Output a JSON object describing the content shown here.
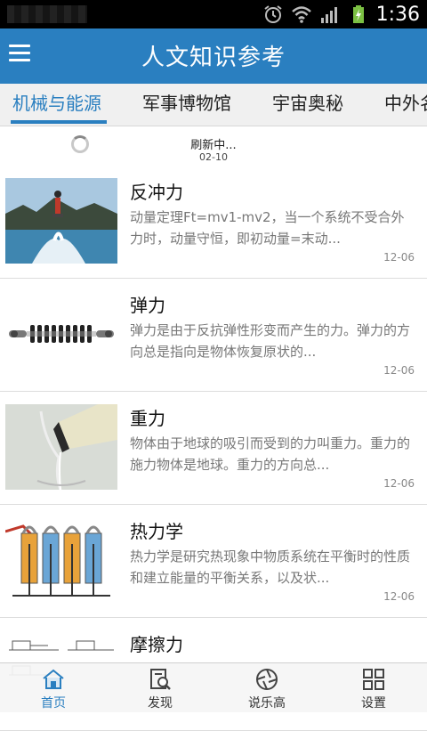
{
  "status_bar": {
    "time": "1:36"
  },
  "app_bar": {
    "title": "人文知识参考"
  },
  "tabs": [
    {
      "label": "机械与能源",
      "active": true
    },
    {
      "label": "军事博物馆",
      "active": false
    },
    {
      "label": "宇宙奥秘",
      "active": false
    },
    {
      "label": "中外名",
      "active": false
    }
  ],
  "refresh": {
    "label": "刷新中...",
    "date": "02-10"
  },
  "articles": [
    {
      "title": "反冲力",
      "desc": "动量定理Ft=mv1-mv2，当一个系统不受合外力时，动量守恒，即初动量=末动...",
      "date": "12-06"
    },
    {
      "title": "弹力",
      "desc": "弹力是由于反抗弹性形变而产生的力。弹力的方向总是指向是物体恢复原状的...",
      "date": "12-06"
    },
    {
      "title": "重力",
      "desc": "物体由于地球的吸引而受到的力叫重力。重力的施力物体是地球。重力的方向总...",
      "date": "12-06"
    },
    {
      "title": "热力学",
      "desc": "热力学是研究热现象中物质系统在平衡时的性质和建立能量的平衡关系，以及状...",
      "date": "12-06"
    },
    {
      "title": "摩擦力",
      "desc": "",
      "date": ""
    }
  ],
  "bottom_nav": [
    {
      "label": "首页",
      "icon": "home-icon",
      "active": true
    },
    {
      "label": "发现",
      "icon": "discover-icon",
      "active": false
    },
    {
      "label": "说乐高",
      "icon": "aperture-icon",
      "active": false
    },
    {
      "label": "设置",
      "icon": "grid-icon",
      "active": false
    }
  ],
  "colors": {
    "primary": "#2a7fc0",
    "status_bar": "#000000",
    "tab_bg": "#f0f0f0"
  }
}
